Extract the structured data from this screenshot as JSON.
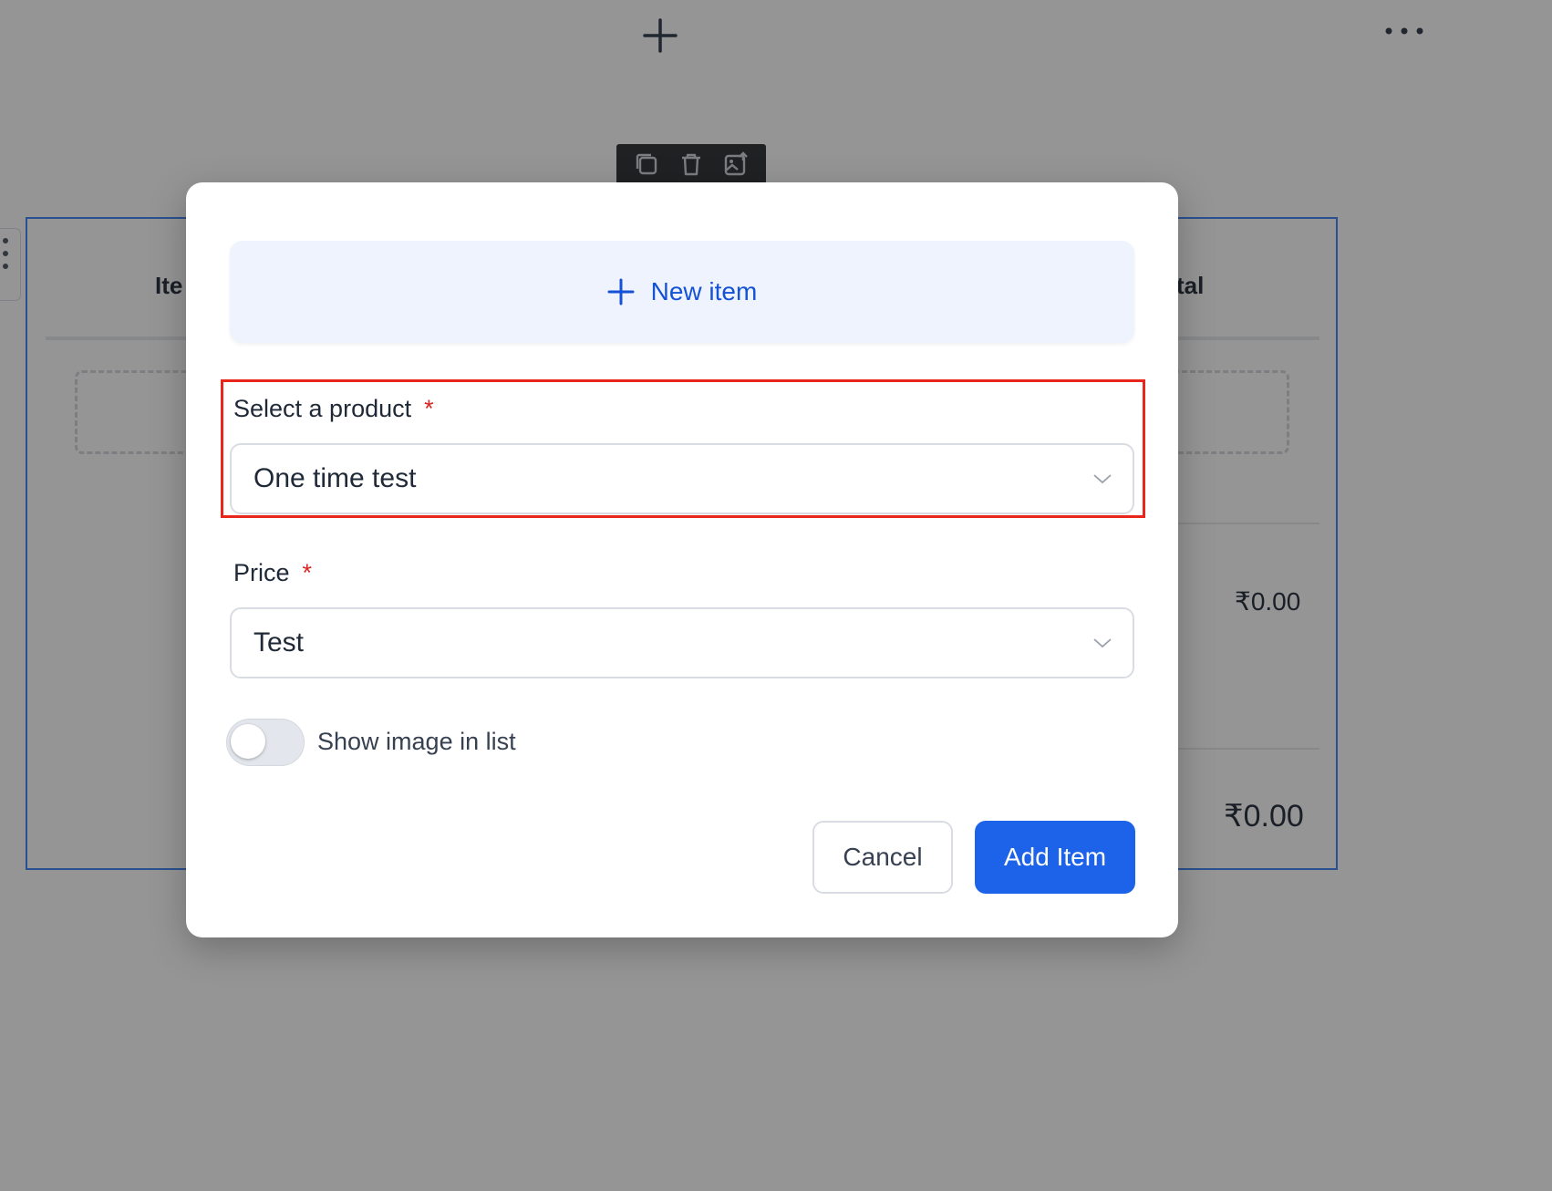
{
  "background": {
    "columns": {
      "item_partial": "Ite",
      "total_partial": "tal"
    },
    "amounts": {
      "row_total": "₹0.00",
      "grand_total": "₹0.00"
    },
    "icons": [
      "plus-icon",
      "more-horizontal-icon",
      "duplicate-icon",
      "trash-icon",
      "replace-image-icon"
    ]
  },
  "modal": {
    "new_item_label": "New item",
    "product_field": {
      "label": "Select a product",
      "required_mark": "*",
      "value": "One time test"
    },
    "price_field": {
      "label": "Price",
      "required_mark": "*",
      "value": "Test"
    },
    "toggle": {
      "label": "Show image in list",
      "on": false
    },
    "buttons": {
      "cancel": "Cancel",
      "add": "Add Item"
    }
  },
  "colors": {
    "primary": "#1d63ea",
    "link": "#1552d6",
    "required": "#dc2626",
    "highlight": "#e8261b"
  }
}
